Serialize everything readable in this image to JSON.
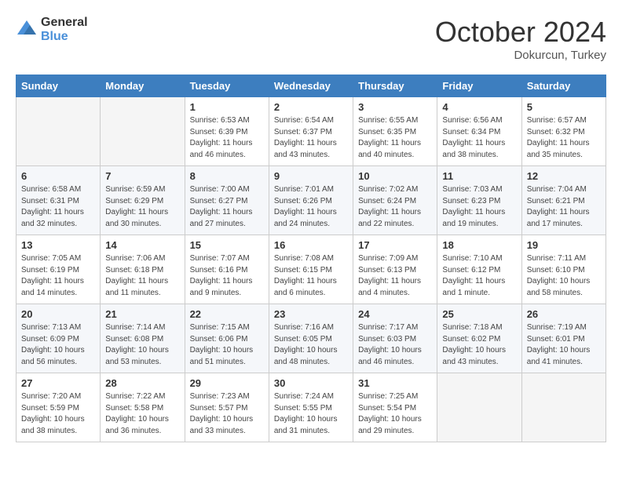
{
  "header": {
    "logo_general": "General",
    "logo_blue": "Blue",
    "month": "October 2024",
    "location": "Dokurcun, Turkey"
  },
  "days_of_week": [
    "Sunday",
    "Monday",
    "Tuesday",
    "Wednesday",
    "Thursday",
    "Friday",
    "Saturday"
  ],
  "weeks": [
    [
      {
        "day": "",
        "info": ""
      },
      {
        "day": "",
        "info": ""
      },
      {
        "day": "1",
        "info": "Sunrise: 6:53 AM\nSunset: 6:39 PM\nDaylight: 11 hours and 46 minutes."
      },
      {
        "day": "2",
        "info": "Sunrise: 6:54 AM\nSunset: 6:37 PM\nDaylight: 11 hours and 43 minutes."
      },
      {
        "day": "3",
        "info": "Sunrise: 6:55 AM\nSunset: 6:35 PM\nDaylight: 11 hours and 40 minutes."
      },
      {
        "day": "4",
        "info": "Sunrise: 6:56 AM\nSunset: 6:34 PM\nDaylight: 11 hours and 38 minutes."
      },
      {
        "day": "5",
        "info": "Sunrise: 6:57 AM\nSunset: 6:32 PM\nDaylight: 11 hours and 35 minutes."
      }
    ],
    [
      {
        "day": "6",
        "info": "Sunrise: 6:58 AM\nSunset: 6:31 PM\nDaylight: 11 hours and 32 minutes."
      },
      {
        "day": "7",
        "info": "Sunrise: 6:59 AM\nSunset: 6:29 PM\nDaylight: 11 hours and 30 minutes."
      },
      {
        "day": "8",
        "info": "Sunrise: 7:00 AM\nSunset: 6:27 PM\nDaylight: 11 hours and 27 minutes."
      },
      {
        "day": "9",
        "info": "Sunrise: 7:01 AM\nSunset: 6:26 PM\nDaylight: 11 hours and 24 minutes."
      },
      {
        "day": "10",
        "info": "Sunrise: 7:02 AM\nSunset: 6:24 PM\nDaylight: 11 hours and 22 minutes."
      },
      {
        "day": "11",
        "info": "Sunrise: 7:03 AM\nSunset: 6:23 PM\nDaylight: 11 hours and 19 minutes."
      },
      {
        "day": "12",
        "info": "Sunrise: 7:04 AM\nSunset: 6:21 PM\nDaylight: 11 hours and 17 minutes."
      }
    ],
    [
      {
        "day": "13",
        "info": "Sunrise: 7:05 AM\nSunset: 6:19 PM\nDaylight: 11 hours and 14 minutes."
      },
      {
        "day": "14",
        "info": "Sunrise: 7:06 AM\nSunset: 6:18 PM\nDaylight: 11 hours and 11 minutes."
      },
      {
        "day": "15",
        "info": "Sunrise: 7:07 AM\nSunset: 6:16 PM\nDaylight: 11 hours and 9 minutes."
      },
      {
        "day": "16",
        "info": "Sunrise: 7:08 AM\nSunset: 6:15 PM\nDaylight: 11 hours and 6 minutes."
      },
      {
        "day": "17",
        "info": "Sunrise: 7:09 AM\nSunset: 6:13 PM\nDaylight: 11 hours and 4 minutes."
      },
      {
        "day": "18",
        "info": "Sunrise: 7:10 AM\nSunset: 6:12 PM\nDaylight: 11 hours and 1 minute."
      },
      {
        "day": "19",
        "info": "Sunrise: 7:11 AM\nSunset: 6:10 PM\nDaylight: 10 hours and 58 minutes."
      }
    ],
    [
      {
        "day": "20",
        "info": "Sunrise: 7:13 AM\nSunset: 6:09 PM\nDaylight: 10 hours and 56 minutes."
      },
      {
        "day": "21",
        "info": "Sunrise: 7:14 AM\nSunset: 6:08 PM\nDaylight: 10 hours and 53 minutes."
      },
      {
        "day": "22",
        "info": "Sunrise: 7:15 AM\nSunset: 6:06 PM\nDaylight: 10 hours and 51 minutes."
      },
      {
        "day": "23",
        "info": "Sunrise: 7:16 AM\nSunset: 6:05 PM\nDaylight: 10 hours and 48 minutes."
      },
      {
        "day": "24",
        "info": "Sunrise: 7:17 AM\nSunset: 6:03 PM\nDaylight: 10 hours and 46 minutes."
      },
      {
        "day": "25",
        "info": "Sunrise: 7:18 AM\nSunset: 6:02 PM\nDaylight: 10 hours and 43 minutes."
      },
      {
        "day": "26",
        "info": "Sunrise: 7:19 AM\nSunset: 6:01 PM\nDaylight: 10 hours and 41 minutes."
      }
    ],
    [
      {
        "day": "27",
        "info": "Sunrise: 7:20 AM\nSunset: 5:59 PM\nDaylight: 10 hours and 38 minutes."
      },
      {
        "day": "28",
        "info": "Sunrise: 7:22 AM\nSunset: 5:58 PM\nDaylight: 10 hours and 36 minutes."
      },
      {
        "day": "29",
        "info": "Sunrise: 7:23 AM\nSunset: 5:57 PM\nDaylight: 10 hours and 33 minutes."
      },
      {
        "day": "30",
        "info": "Sunrise: 7:24 AM\nSunset: 5:55 PM\nDaylight: 10 hours and 31 minutes."
      },
      {
        "day": "31",
        "info": "Sunrise: 7:25 AM\nSunset: 5:54 PM\nDaylight: 10 hours and 29 minutes."
      },
      {
        "day": "",
        "info": ""
      },
      {
        "day": "",
        "info": ""
      }
    ]
  ]
}
